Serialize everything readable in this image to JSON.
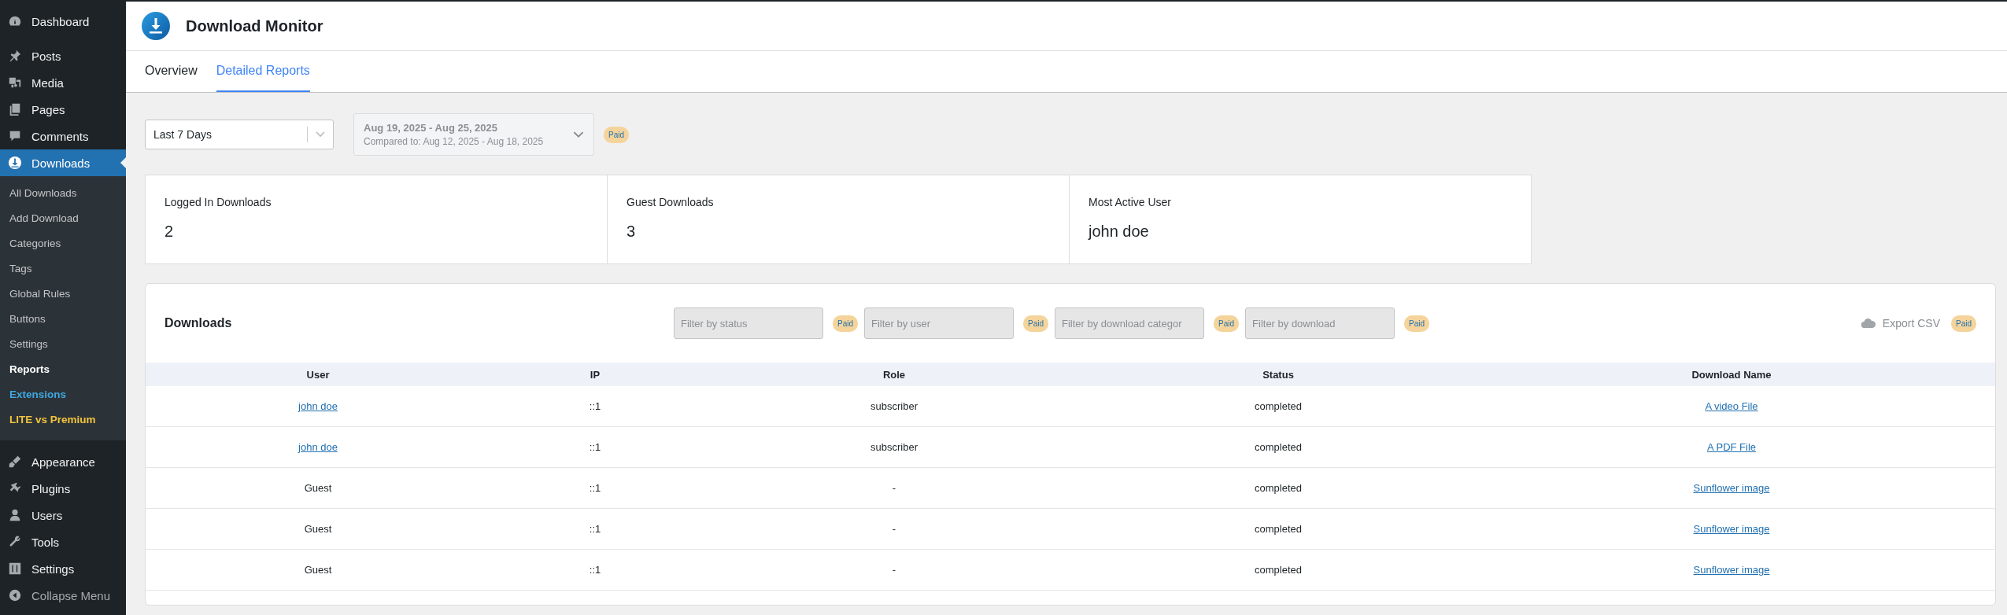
{
  "sidebar": {
    "items": [
      {
        "label": "Dashboard",
        "selected": false
      },
      {
        "label": "Posts",
        "selected": false
      },
      {
        "label": "Media",
        "selected": false
      },
      {
        "label": "Pages",
        "selected": false
      },
      {
        "label": "Comments",
        "selected": false
      },
      {
        "label": "Downloads",
        "selected": true,
        "children": [
          {
            "label": "All Downloads",
            "kind": "normal",
            "selected": false
          },
          {
            "label": "Add Download",
            "kind": "normal",
            "selected": false
          },
          {
            "label": "Categories",
            "kind": "normal",
            "selected": false
          },
          {
            "label": "Tags",
            "kind": "normal",
            "selected": false
          },
          {
            "label": "Global Rules",
            "kind": "normal",
            "selected": false
          },
          {
            "label": "Buttons",
            "kind": "normal",
            "selected": false
          },
          {
            "label": "Settings",
            "kind": "normal",
            "selected": false
          },
          {
            "label": "Reports",
            "kind": "normal",
            "selected": true
          },
          {
            "label": "Extensions",
            "kind": "extensions",
            "selected": false
          },
          {
            "label": "LITE vs Premium",
            "kind": "premium",
            "selected": false
          }
        ]
      },
      {
        "label": "Appearance",
        "selected": false
      },
      {
        "label": "Plugins",
        "selected": false
      },
      {
        "label": "Users",
        "selected": false
      },
      {
        "label": "Tools",
        "selected": false
      },
      {
        "label": "Settings",
        "selected": false
      },
      {
        "label": "Collapse Menu",
        "selected": false
      }
    ]
  },
  "header": {
    "title": "Download Monitor"
  },
  "tabs": [
    {
      "label": "Overview",
      "selected": false
    },
    {
      "label": "Detailed Reports",
      "selected": true
    }
  ],
  "period_select": {
    "value": "Last 7 Days"
  },
  "date_range": {
    "range": "Aug 19, 2025 - Aug 25, 2025",
    "compared": "Compared to: Aug 12, 2025 - Aug 18, 2025",
    "badge": "Paid"
  },
  "stats": [
    {
      "label": "Logged In Downloads",
      "value": "2"
    },
    {
      "label": "Guest Downloads",
      "value": "3"
    },
    {
      "label": "Most Active User",
      "value": "john doe"
    }
  ],
  "downloads": {
    "title": "Downloads",
    "filters": [
      {
        "placeholder": "Filter by status",
        "badge": "Paid"
      },
      {
        "placeholder": "Filter by user",
        "badge": "Paid"
      },
      {
        "placeholder": "Filter by download categor",
        "badge": "Paid"
      },
      {
        "placeholder": "Filter by download",
        "badge": "Paid"
      }
    ],
    "export": {
      "label": "Export CSV",
      "badge": "Paid"
    },
    "table": {
      "columns": [
        "User",
        "IP",
        "Role",
        "Status",
        "Download Name"
      ],
      "rows": [
        {
          "user": "john doe",
          "user_link": true,
          "ip": "::1",
          "role": "subscriber",
          "status": "completed",
          "download": "A video File"
        },
        {
          "user": "john doe",
          "user_link": true,
          "ip": "::1",
          "role": "subscriber",
          "status": "completed",
          "download": "A PDF File"
        },
        {
          "user": "Guest",
          "user_link": false,
          "ip": "::1",
          "role": "-",
          "status": "completed",
          "download": "Sunflower image"
        },
        {
          "user": "Guest",
          "user_link": false,
          "ip": "::1",
          "role": "-",
          "status": "completed",
          "download": "Sunflower image"
        },
        {
          "user": "Guest",
          "user_link": false,
          "ip": "::1",
          "role": "-",
          "status": "completed",
          "download": "Sunflower image"
        }
      ]
    }
  }
}
